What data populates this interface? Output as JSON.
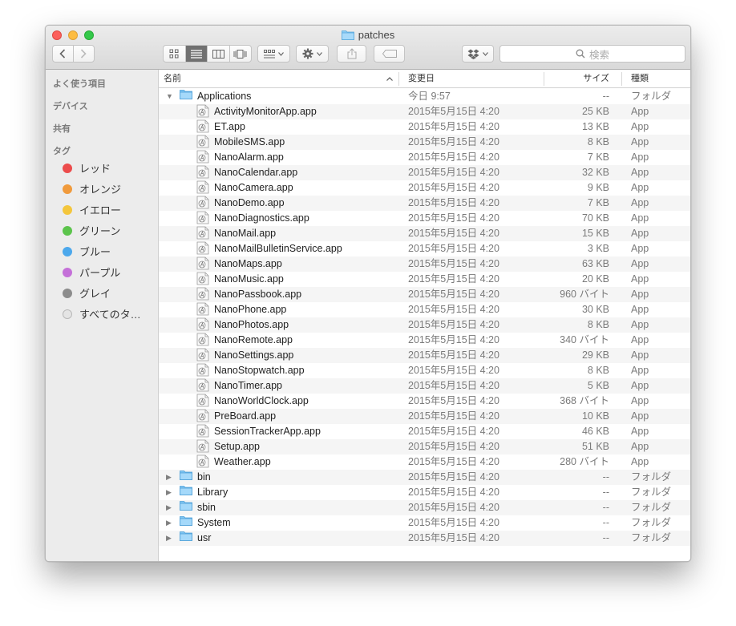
{
  "window": {
    "title": "patches"
  },
  "toolbar": {
    "search_placeholder": "検索"
  },
  "sidebar": {
    "sections": [
      "よく使う項目",
      "デバイス",
      "共有",
      "タグ"
    ],
    "tags": [
      {
        "label": "レッド",
        "color": "#ec4c4c"
      },
      {
        "label": "オレンジ",
        "color": "#f09a3c"
      },
      {
        "label": "イエロー",
        "color": "#f4c63c"
      },
      {
        "label": "グリーン",
        "color": "#5cc44c"
      },
      {
        "label": "ブルー",
        "color": "#4ca8ec"
      },
      {
        "label": "パープル",
        "color": "#c470d8"
      },
      {
        "label": "グレイ",
        "color": "#8c8c8c"
      },
      {
        "label": "すべてのタ…",
        "color": "#e4e4e4"
      }
    ]
  },
  "columns": {
    "name": "名前",
    "date": "変更日",
    "size": "サイズ",
    "kind": "種類"
  },
  "rows": [
    {
      "name": "Applications",
      "date": "今日 9:57",
      "size": "--",
      "kind": "フォルダ",
      "type": "folder",
      "expanded": true,
      "level": 0
    },
    {
      "name": "ActivityMonitorApp.app",
      "date": "2015年5月15日 4:20",
      "size": "25 KB",
      "kind": "App",
      "type": "app",
      "level": 1
    },
    {
      "name": "ET.app",
      "date": "2015年5月15日 4:20",
      "size": "13 KB",
      "kind": "App",
      "type": "app",
      "level": 1
    },
    {
      "name": "MobileSMS.app",
      "date": "2015年5月15日 4:20",
      "size": "8 KB",
      "kind": "App",
      "type": "app",
      "level": 1
    },
    {
      "name": "NanoAlarm.app",
      "date": "2015年5月15日 4:20",
      "size": "7 KB",
      "kind": "App",
      "type": "app",
      "level": 1
    },
    {
      "name": "NanoCalendar.app",
      "date": "2015年5月15日 4:20",
      "size": "32 KB",
      "kind": "App",
      "type": "app",
      "level": 1
    },
    {
      "name": "NanoCamera.app",
      "date": "2015年5月15日 4:20",
      "size": "9 KB",
      "kind": "App",
      "type": "app",
      "level": 1
    },
    {
      "name": "NanoDemo.app",
      "date": "2015年5月15日 4:20",
      "size": "7 KB",
      "kind": "App",
      "type": "app",
      "level": 1
    },
    {
      "name": "NanoDiagnostics.app",
      "date": "2015年5月15日 4:20",
      "size": "70 KB",
      "kind": "App",
      "type": "app",
      "level": 1
    },
    {
      "name": "NanoMail.app",
      "date": "2015年5月15日 4:20",
      "size": "15 KB",
      "kind": "App",
      "type": "app",
      "level": 1
    },
    {
      "name": "NanoMailBulletinService.app",
      "date": "2015年5月15日 4:20",
      "size": "3 KB",
      "kind": "App",
      "type": "app",
      "level": 1
    },
    {
      "name": "NanoMaps.app",
      "date": "2015年5月15日 4:20",
      "size": "63 KB",
      "kind": "App",
      "type": "app",
      "level": 1
    },
    {
      "name": "NanoMusic.app",
      "date": "2015年5月15日 4:20",
      "size": "20 KB",
      "kind": "App",
      "type": "app",
      "level": 1
    },
    {
      "name": "NanoPassbook.app",
      "date": "2015年5月15日 4:20",
      "size": "960 バイト",
      "kind": "App",
      "type": "app",
      "level": 1
    },
    {
      "name": "NanoPhone.app",
      "date": "2015年5月15日 4:20",
      "size": "30 KB",
      "kind": "App",
      "type": "app",
      "level": 1
    },
    {
      "name": "NanoPhotos.app",
      "date": "2015年5月15日 4:20",
      "size": "8 KB",
      "kind": "App",
      "type": "app",
      "level": 1
    },
    {
      "name": "NanoRemote.app",
      "date": "2015年5月15日 4:20",
      "size": "340 バイト",
      "kind": "App",
      "type": "app",
      "level": 1
    },
    {
      "name": "NanoSettings.app",
      "date": "2015年5月15日 4:20",
      "size": "29 KB",
      "kind": "App",
      "type": "app",
      "level": 1
    },
    {
      "name": "NanoStopwatch.app",
      "date": "2015年5月15日 4:20",
      "size": "8 KB",
      "kind": "App",
      "type": "app",
      "level": 1
    },
    {
      "name": "NanoTimer.app",
      "date": "2015年5月15日 4:20",
      "size": "5 KB",
      "kind": "App",
      "type": "app",
      "level": 1
    },
    {
      "name": "NanoWorldClock.app",
      "date": "2015年5月15日 4:20",
      "size": "368 バイト",
      "kind": "App",
      "type": "app",
      "level": 1
    },
    {
      "name": "PreBoard.app",
      "date": "2015年5月15日 4:20",
      "size": "10 KB",
      "kind": "App",
      "type": "app",
      "level": 1
    },
    {
      "name": "SessionTrackerApp.app",
      "date": "2015年5月15日 4:20",
      "size": "46 KB",
      "kind": "App",
      "type": "app",
      "level": 1
    },
    {
      "name": "Setup.app",
      "date": "2015年5月15日 4:20",
      "size": "51 KB",
      "kind": "App",
      "type": "app",
      "level": 1
    },
    {
      "name": "Weather.app",
      "date": "2015年5月15日 4:20",
      "size": "280 バイト",
      "kind": "App",
      "type": "app",
      "level": 1
    },
    {
      "name": "bin",
      "date": "2015年5月15日 4:20",
      "size": "--",
      "kind": "フォルダ",
      "type": "folder",
      "expanded": false,
      "level": 0
    },
    {
      "name": "Library",
      "date": "2015年5月15日 4:20",
      "size": "--",
      "kind": "フォルダ",
      "type": "folder",
      "expanded": false,
      "level": 0
    },
    {
      "name": "sbin",
      "date": "2015年5月15日 4:20",
      "size": "--",
      "kind": "フォルダ",
      "type": "folder",
      "expanded": false,
      "level": 0
    },
    {
      "name": "System",
      "date": "2015年5月15日 4:20",
      "size": "--",
      "kind": "フォルダ",
      "type": "folder",
      "expanded": false,
      "level": 0
    },
    {
      "name": "usr",
      "date": "2015年5月15日 4:20",
      "size": "--",
      "kind": "フォルダ",
      "type": "folder",
      "expanded": false,
      "level": 0
    }
  ]
}
